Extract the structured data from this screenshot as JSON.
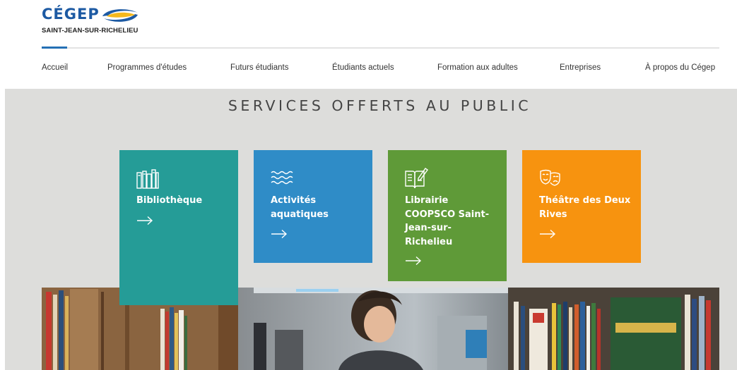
{
  "brand": {
    "name": "CÉGEP",
    "subtitle": "SAINT-JEAN-SUR-RICHELIEU",
    "colors": {
      "primary": "#1d5aa3",
      "accent": "#f5b81c"
    }
  },
  "nav": {
    "items": [
      {
        "label": "Accueil"
      },
      {
        "label": "Programmes d'études"
      },
      {
        "label": "Futurs étudiants"
      },
      {
        "label": "Étudiants actuels"
      },
      {
        "label": "Formation aux adultes"
      },
      {
        "label": "Entreprises"
      },
      {
        "label": "À propos du Cégep"
      }
    ],
    "active_color": "#2470b5"
  },
  "services": {
    "title": "SERVICES OFFERTS AU PUBLIC",
    "background": "#dddddb",
    "tiles": [
      {
        "label": "Bibliothèque",
        "icon": "books-icon",
        "color": "#259c97"
      },
      {
        "label": "Activités aquatiques",
        "icon": "waves-icon",
        "color": "#2f8cc7"
      },
      {
        "label": "Librairie COOPSCO Saint-Jean-sur-Richelieu",
        "icon": "book-pen-icon",
        "color": "#5f9a38"
      },
      {
        "label": "Théâtre des Deux Rives",
        "icon": "theater-masks-icon",
        "color": "#f7930f"
      }
    ]
  }
}
